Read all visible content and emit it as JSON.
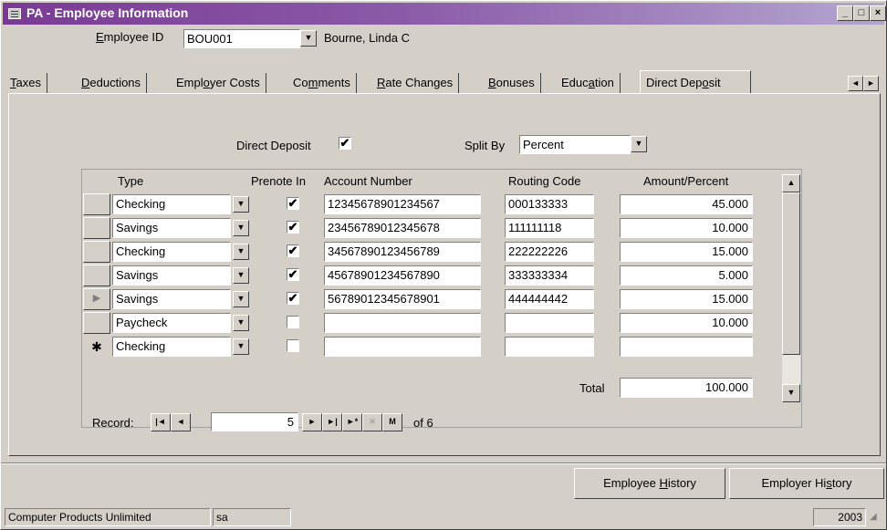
{
  "window": {
    "title": "PA - Employee Information",
    "buttons": {
      "minimize": "_",
      "maximize": "□",
      "close": "×"
    }
  },
  "header": {
    "employee_id": {
      "label_pre": "",
      "label_ul": "E",
      "label_post": "mployee ID",
      "value": "BOU001",
      "name": "Bourne, Linda C"
    }
  },
  "tabs": [
    {
      "pre": "",
      "ul": "T",
      "post": "axes"
    },
    {
      "pre": "",
      "ul": "D",
      "post": "eductions"
    },
    {
      "pre": "Empl",
      "ul": "o",
      "post": "yer Costs"
    },
    {
      "pre": "Co",
      "ul": "m",
      "post": "ments"
    },
    {
      "pre": "",
      "ul": "R",
      "post": "ate Changes"
    },
    {
      "pre": "",
      "ul": "B",
      "post": "onuses"
    },
    {
      "pre": "Educ",
      "ul": "a",
      "post": "tion"
    },
    {
      "pre": "Direct Dep",
      "ul": "o",
      "post": "sit"
    }
  ],
  "tab_scroll": {
    "left": "◄",
    "right": "►"
  },
  "direct_deposit": {
    "label": "Direct Deposit",
    "checked": "✔",
    "split_by_label": "Split By",
    "split_by_value": "Percent"
  },
  "grid": {
    "columns": [
      "Type",
      "Prenote In",
      "Account Number",
      "Routing Code",
      "Amount/Percent"
    ],
    "rows": [
      {
        "type": "Checking",
        "prenote": "✔",
        "account": "12345678901234567",
        "routing": "000133333",
        "amount": "45.000"
      },
      {
        "type": "Savings",
        "prenote": "✔",
        "account": "23456789012345678",
        "routing": "111111118",
        "amount": "10.000"
      },
      {
        "type": "Checking",
        "prenote": "✔",
        "account": "34567890123456789",
        "routing": "222222226",
        "amount": "15.000"
      },
      {
        "type": "Savings",
        "prenote": "✔",
        "account": "45678901234567890",
        "routing": "333333334",
        "amount": "5.000"
      },
      {
        "type": "Savings",
        "prenote": "✔",
        "account": "56789012345678901",
        "routing": "444444442",
        "amount": "15.000"
      },
      {
        "type": "Paycheck",
        "prenote": "",
        "account": "",
        "routing": "",
        "amount": "10.000"
      },
      {
        "type": "Checking",
        "prenote": "",
        "account": "",
        "routing": "",
        "amount": ""
      }
    ],
    "current_row_marker": "▶",
    "new_row_marker": "✱",
    "total_label": "Total",
    "total_value": "100.000"
  },
  "record_nav": {
    "label": "Record:",
    "current": "5",
    "of_label": "of",
    "total": "6",
    "first": "|◄",
    "prev": "◄",
    "next": "►",
    "last": "►|",
    "new": "►*",
    "delete": "✕",
    "flag": "M"
  },
  "bottom_buttons": {
    "employee_history": {
      "pre": "Employee ",
      "ul": "H",
      "post": "istory"
    },
    "employer_history": {
      "pre": "Employer Hi",
      "ul": "s",
      "post": "tory"
    }
  },
  "status_bar": {
    "company": "Computer Products Unlimited",
    "user": "sa",
    "year": "2003"
  }
}
